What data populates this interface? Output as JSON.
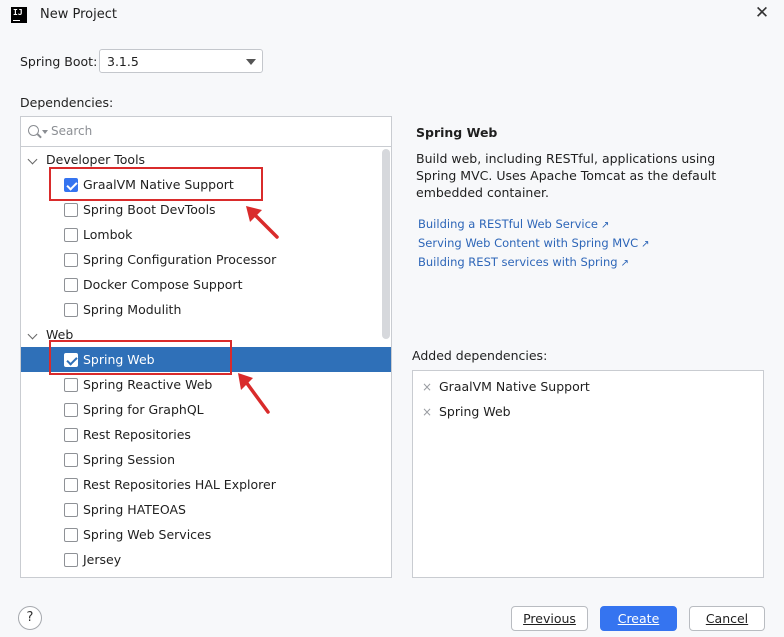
{
  "window": {
    "title": "New Project",
    "app_icon_text": "IJ",
    "close_icon": "close-icon"
  },
  "spring_boot": {
    "label": "Spring Boot:",
    "version": "3.1.5"
  },
  "dependencies": {
    "label": "Dependencies:",
    "search_placeholder": "Search",
    "groups": [
      {
        "name": "Developer Tools",
        "items": [
          {
            "label": "GraalVM Native Support",
            "checked": true
          },
          {
            "label": "Spring Boot DevTools",
            "checked": false
          },
          {
            "label": "Lombok",
            "checked": false
          },
          {
            "label": "Spring Configuration Processor",
            "checked": false
          },
          {
            "label": "Docker Compose Support",
            "checked": false
          },
          {
            "label": "Spring Modulith",
            "checked": false
          }
        ]
      },
      {
        "name": "Web",
        "items": [
          {
            "label": "Spring Web",
            "checked": true,
            "selected": true
          },
          {
            "label": "Spring Reactive Web",
            "checked": false
          },
          {
            "label": "Spring for GraphQL",
            "checked": false
          },
          {
            "label": "Rest Repositories",
            "checked": false
          },
          {
            "label": "Spring Session",
            "checked": false
          },
          {
            "label": "Rest Repositories HAL Explorer",
            "checked": false
          },
          {
            "label": "Spring HATEOAS",
            "checked": false
          },
          {
            "label": "Spring Web Services",
            "checked": false
          },
          {
            "label": "Jersey",
            "checked": false
          }
        ]
      }
    ]
  },
  "detail": {
    "title": "Spring Web",
    "description": "Build web, including RESTful, applications using Spring MVC. Uses Apache Tomcat as the default embedded container.",
    "links": [
      "Building a RESTful Web Service",
      "Serving Web Content with Spring MVC",
      "Building REST services with Spring"
    ],
    "link_icon": "↗"
  },
  "added": {
    "label": "Added dependencies:",
    "items": [
      "GraalVM Native Support",
      "Spring Web"
    ],
    "remove_icon": "×"
  },
  "footer": {
    "help": "?",
    "previous": "Previous",
    "create": "Create",
    "cancel": "Cancel"
  },
  "colors": {
    "accent": "#3574f0",
    "selection": "#2f70b8",
    "annotation": "#d92b2b",
    "link": "#2e66b8"
  }
}
